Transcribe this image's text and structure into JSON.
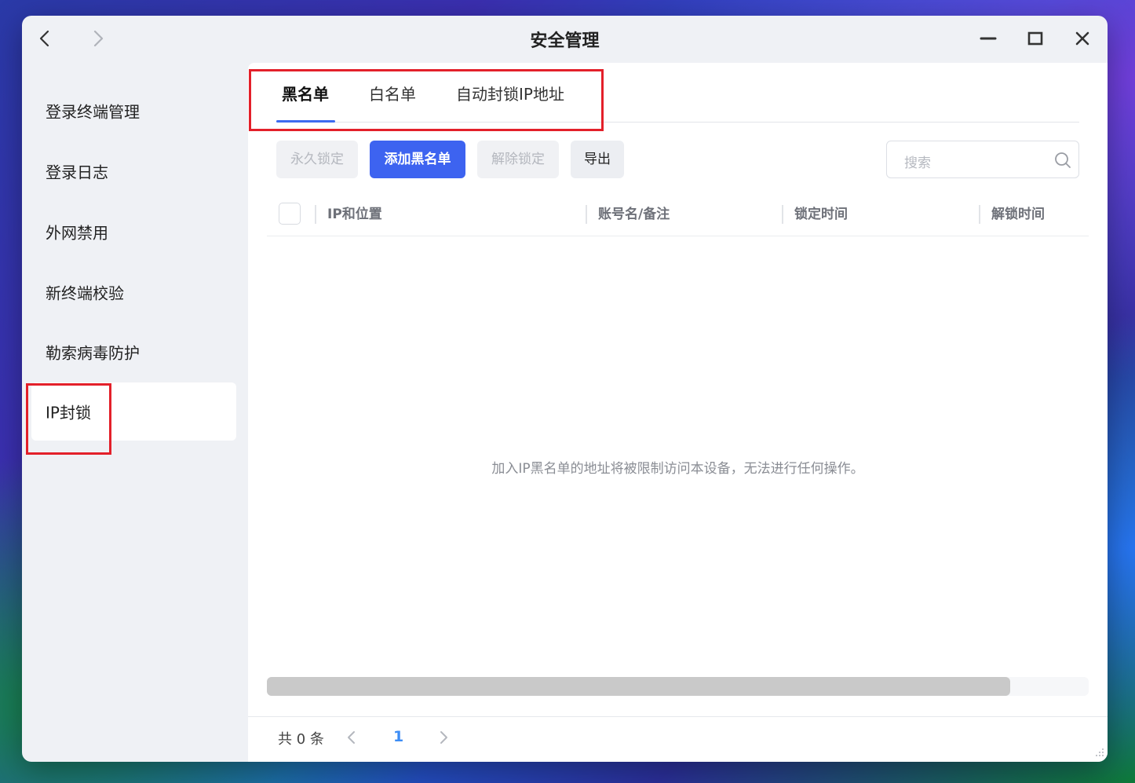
{
  "window": {
    "title": "安全管理"
  },
  "sidebar": {
    "items": [
      {
        "label": "登录终端管理"
      },
      {
        "label": "登录日志"
      },
      {
        "label": "外网禁用"
      },
      {
        "label": "新终端校验"
      },
      {
        "label": "勒索病毒防护"
      },
      {
        "label": "IP封锁",
        "active": true
      }
    ]
  },
  "tabs": [
    {
      "label": "黑名单",
      "active": true
    },
    {
      "label": "白名单"
    },
    {
      "label": "自动封锁IP地址"
    }
  ],
  "toolbar": {
    "permanent_lock": "永久锁定",
    "add_blacklist": "添加黑名单",
    "unlock": "解除锁定",
    "export": "导出"
  },
  "search": {
    "placeholder": "搜索"
  },
  "table": {
    "columns": [
      "IP和位置",
      "账号名/备注",
      "锁定时间",
      "解锁时间"
    ],
    "rows": [],
    "empty_message": "加入IP黑名单的地址将被限制访问本设备，无法进行任何操作。"
  },
  "pagination": {
    "total_label": "共 0 条",
    "current_page": "1"
  },
  "colors": {
    "accent": "#3d63f0",
    "highlight_box": "#e3202a",
    "page_active": "#3d8df5"
  }
}
